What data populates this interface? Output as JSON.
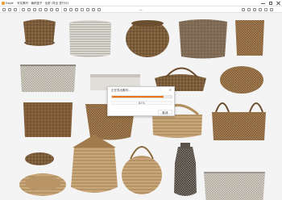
{
  "app": {
    "name": "Eagle",
    "title": "写实素材 · 编织篮子 · 全部 (导出 进行中)"
  },
  "toolbar": {
    "center_caret": "︿"
  },
  "dialog": {
    "title": "正在导出素材…",
    "progress": 0.87,
    "progress_text": "87%",
    "cancel_label": "取消"
  },
  "canvas": {
    "background": "#f4f4f4",
    "accent": "#e87420"
  }
}
